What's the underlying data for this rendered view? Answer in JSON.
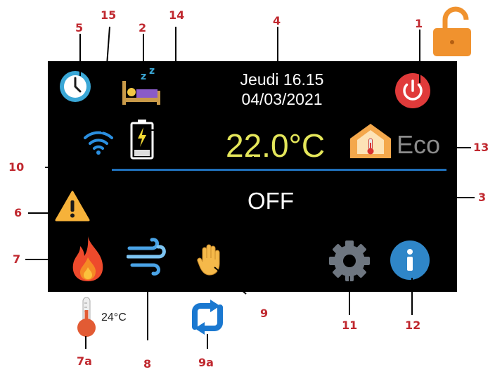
{
  "screen": {
    "day_time": "Jeudi 16.15",
    "date": "04/03/2021",
    "temperature": "22.0°C",
    "eco_label": "Eco",
    "status": "OFF"
  },
  "external": {
    "outdoor_temp": "24°C"
  },
  "callouts": {
    "c1": "1",
    "c2": "2",
    "c3": "3",
    "c4": "4",
    "c5": "5",
    "c6": "6",
    "c7": "7",
    "c7a": "7a",
    "c8": "8",
    "c9": "9",
    "c9a": "9a",
    "c10": "10",
    "c11": "11",
    "c12": "12",
    "c13": "13",
    "c14": "14",
    "c15": "15"
  },
  "icons": {
    "lock": "lock-open-icon",
    "clock": "clock-icon",
    "sleep": "sleep-bed-icon",
    "wifi": "wifi-icon",
    "battery": "battery-charging-icon",
    "power": "power-icon",
    "house": "house-thermometer-icon",
    "warning": "warning-icon",
    "flame": "flame-icon",
    "wind": "wind-icon",
    "hand": "hand-icon",
    "gear": "gear-icon",
    "info": "info-icon",
    "thermometer": "thermometer-icon",
    "sync": "sync-icon"
  },
  "colors": {
    "screen_bg": "#000000",
    "callout": "#c0282f",
    "temperature": "#e4e65a",
    "power": "#e03a3a",
    "lock": "#f0922e",
    "clock": "#3aa7d6",
    "separator": "#1f6fb8",
    "info": "#2f86c8",
    "gear": "#6e7680",
    "warning": "#f6b23a",
    "sync": "#1a78d0"
  }
}
